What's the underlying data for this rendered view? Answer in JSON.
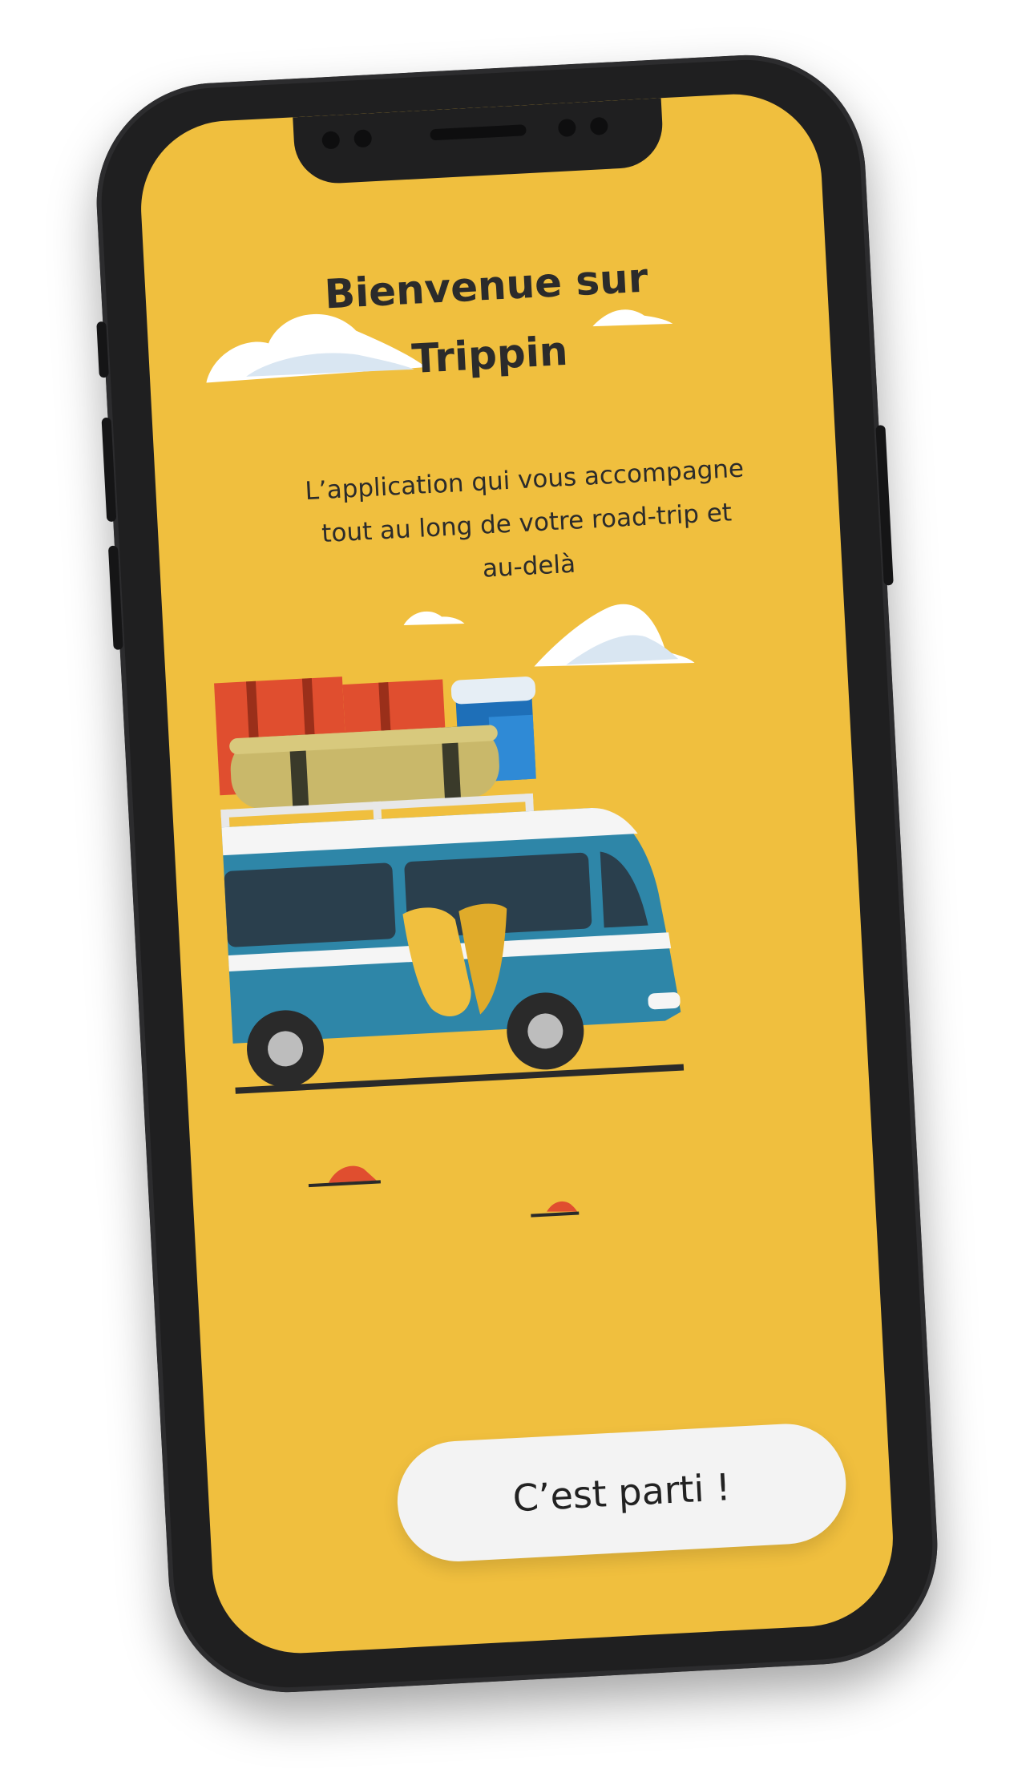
{
  "screen": {
    "title_line1": "Bienvenue sur",
    "title_line2": "Trippin",
    "subtitle_line1": "L’application qui vous accompagne",
    "subtitle_line2": "tout au long de votre road-trip et",
    "subtitle_line3": "au-delà",
    "cta_label": "C’est parti !"
  },
  "colors": {
    "background": "#f0bf3e",
    "phone_frame": "#1f1f20",
    "van_body": "#2e86a8",
    "button": "#f3f3f3",
    "text": "#2b2b2b"
  },
  "icons": {
    "illustration": "van-illustration",
    "clouds": "cloud-icon",
    "rocks": "rock-icon"
  }
}
